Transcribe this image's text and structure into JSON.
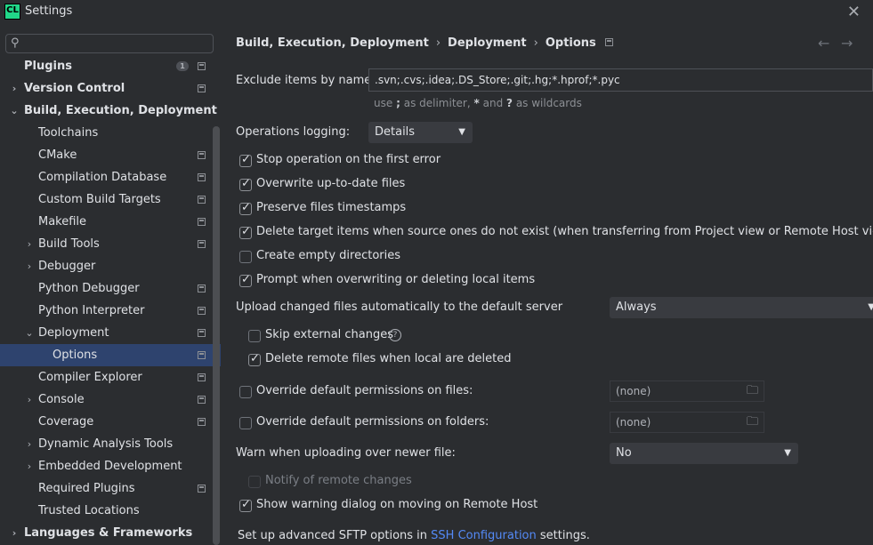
{
  "window": {
    "app_icon": "CL",
    "title": "Settings",
    "close_glyph": "✕"
  },
  "search": {
    "placeholder": "",
    "value": ""
  },
  "sidebar": {
    "items": [
      {
        "label": "Plugins",
        "level": 0,
        "bold": true,
        "chevron": "",
        "badge": "1",
        "project_icon": true
      },
      {
        "label": "Version Control",
        "level": 0,
        "bold": true,
        "chevron": "›",
        "project_icon": true
      },
      {
        "label": "Build, Execution, Deployment",
        "level": 0,
        "bold": true,
        "chevron": "⌄",
        "project_icon": false
      },
      {
        "label": "Toolchains",
        "level": 1,
        "chevron": "",
        "project_icon": false
      },
      {
        "label": "CMake",
        "level": 1,
        "chevron": "",
        "project_icon": true
      },
      {
        "label": "Compilation Database",
        "level": 1,
        "chevron": "",
        "project_icon": true
      },
      {
        "label": "Custom Build Targets",
        "level": 1,
        "chevron": "",
        "project_icon": true
      },
      {
        "label": "Makefile",
        "level": 1,
        "chevron": "",
        "project_icon": true
      },
      {
        "label": "Build Tools",
        "level": 1,
        "chevron": "›",
        "project_icon": true
      },
      {
        "label": "Debugger",
        "level": 1,
        "chevron": "›",
        "project_icon": false
      },
      {
        "label": "Python Debugger",
        "level": 1,
        "chevron": "",
        "project_icon": true
      },
      {
        "label": "Python Interpreter",
        "level": 1,
        "chevron": "",
        "project_icon": true
      },
      {
        "label": "Deployment",
        "level": 1,
        "chevron": "⌄",
        "project_icon": true
      },
      {
        "label": "Options",
        "level": 2,
        "chevron": "",
        "project_icon": true,
        "selected": true
      },
      {
        "label": "Compiler Explorer",
        "level": 1,
        "chevron": "",
        "project_icon": true
      },
      {
        "label": "Console",
        "level": 1,
        "chevron": "›",
        "project_icon": true
      },
      {
        "label": "Coverage",
        "level": 1,
        "chevron": "",
        "project_icon": true
      },
      {
        "label": "Dynamic Analysis Tools",
        "level": 1,
        "chevron": "›",
        "project_icon": false
      },
      {
        "label": "Embedded Development",
        "level": 1,
        "chevron": "›",
        "project_icon": false
      },
      {
        "label": "Required Plugins",
        "level": 1,
        "chevron": "",
        "project_icon": true
      },
      {
        "label": "Trusted Locations",
        "level": 1,
        "chevron": "",
        "project_icon": false
      },
      {
        "label": "Languages & Frameworks",
        "level": 0,
        "bold": true,
        "chevron": "›",
        "project_icon": false
      }
    ]
  },
  "breadcrumb": {
    "parts": [
      "Build, Execution, Deployment",
      "Deployment",
      "Options"
    ],
    "separator": "›",
    "back_glyph": "←",
    "forward_glyph": "→"
  },
  "form": {
    "exclude_label": "Exclude items by name:",
    "exclude_value": ".svn;.cvs;.idea;.DS_Store;.git;.hg;*.hprof;*.pyc",
    "hint_pre": "use",
    "hint_sep": ";",
    "hint_mid": "as delimiter,",
    "hint_star": "*",
    "hint_and": "and",
    "hint_q": "?",
    "hint_post": "as wildcards",
    "ops_logging_label": "Operations logging:",
    "ops_logging_value": "Details",
    "checkboxes": [
      {
        "label": "Stop operation on the first error",
        "checked": true
      },
      {
        "label": "Overwrite up-to-date files",
        "checked": true
      },
      {
        "label": "Preserve files timestamps",
        "checked": true
      },
      {
        "label": "Delete target items when source ones do not exist (when transferring from Project view or Remote Host view)",
        "checked": true
      },
      {
        "label": "Create empty directories",
        "checked": false
      },
      {
        "label": "Prompt when overwriting or deleting local items",
        "checked": true
      }
    ],
    "upload_label": "Upload changed files automatically to the default server",
    "upload_value": "Always",
    "skip_external": {
      "label": "Skip external changes",
      "checked": false,
      "help": "?"
    },
    "delete_remote": {
      "label": "Delete remote files when local are deleted",
      "checked": true
    },
    "override_files": {
      "label": "Override default permissions on files:",
      "checked": false,
      "value": "(none)"
    },
    "override_folders": {
      "label": "Override default permissions on folders:",
      "checked": false,
      "value": "(none)"
    },
    "warn_label": "Warn when uploading over newer file:",
    "warn_value": "No",
    "notify_remote": {
      "label": "Notify of remote changes",
      "checked": false,
      "disabled": true
    },
    "show_warning": {
      "label": "Show warning dialog on moving on Remote Host",
      "checked": true
    },
    "sftp_pre": "Set up advanced SFTP options in",
    "sftp_link": "SSH Configuration",
    "sftp_post": "settings."
  },
  "colors": {
    "selection": "#2e436e",
    "link": "#548af7",
    "background": "#2b2d30"
  }
}
